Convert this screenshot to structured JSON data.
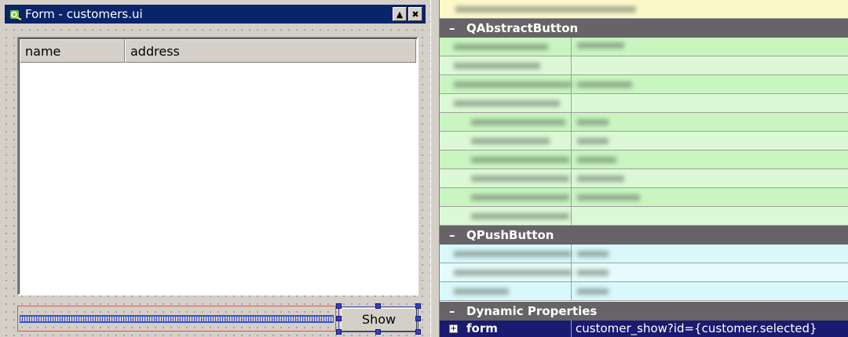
{
  "window": {
    "title": "Form - customers.ui",
    "minimize_label": "▲",
    "close_label": "✖"
  },
  "table": {
    "columns": [
      "name",
      "address"
    ]
  },
  "buttons": {
    "show_label": "Show"
  },
  "property_editor": {
    "groups": [
      {
        "title": "QAbstractButton",
        "color": "#c8f5c0"
      },
      {
        "title": "QPushButton",
        "color": "#d8f8fc"
      },
      {
        "title": "Dynamic Properties"
      }
    ],
    "dynamic_property": {
      "name": "form",
      "value": "customer_show?id={customer.selected}"
    }
  },
  "icons": [
    "qt-designer-app-icon",
    "minimize-icon",
    "close-icon",
    "expand-icon"
  ],
  "colors": {
    "titlebar": "#0a246a",
    "group_header": "#666466",
    "selected_row": "#1a1a70",
    "spacer": "#1e3ccf",
    "handles": "#3140c8"
  }
}
